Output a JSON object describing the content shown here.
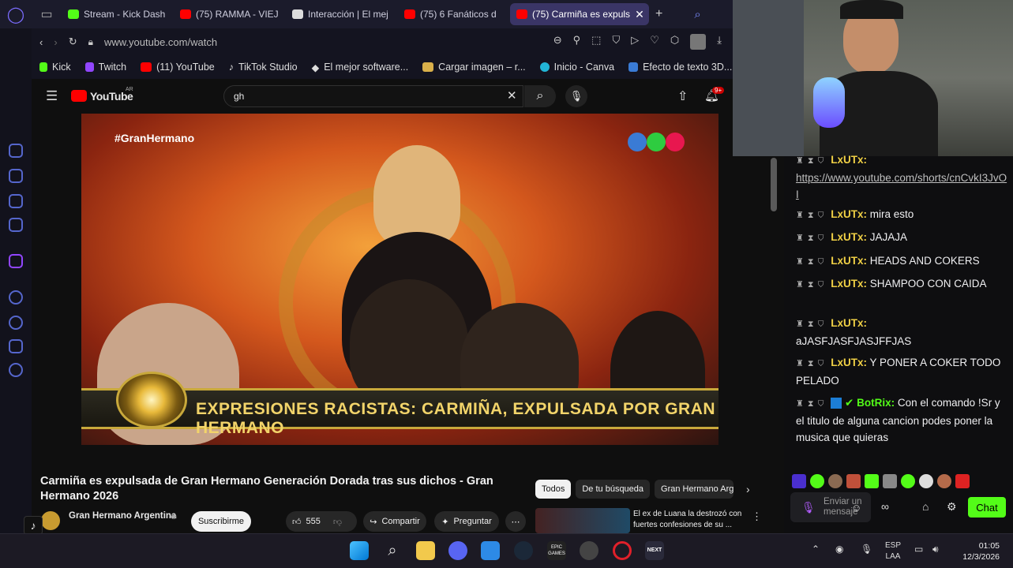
{
  "browser": {
    "tabs": [
      {
        "label": "Stream - Kick Dash",
        "color": "#53fc18"
      },
      {
        "label": "(75) RAMMA - VIEJ",
        "color": "#ff0000"
      },
      {
        "label": "Interacción | El mej",
        "color": "#dddddd"
      },
      {
        "label": "(75) 6 Fanáticos d",
        "color": "#ff0000"
      },
      {
        "label": "(75) Carmiña es expuls",
        "color": "#ff0000"
      }
    ],
    "url": "www.youtube.com/watch",
    "bookmarks": [
      "Kick",
      "Twitch",
      "(11) YouTube",
      "TikTok Studio",
      "El mejor software...",
      "Cargar imagen – r...",
      "Inicio - Canva",
      "Efecto de texto 3D..."
    ]
  },
  "youtube": {
    "logo": "YouTube",
    "region": "AR",
    "search_value": "gh",
    "notif_count": "9+",
    "video": {
      "hashtag": "#GranHermano",
      "banner": "EXPRESIONES RACISTAS: CARMIÑA, EXPULSADA POR GRAN HERMANO",
      "title": "Carmiña es expulsada de Gran Hermano Generación Dorada tras sus dichos - Gran Hermano 2026"
    },
    "channel": "Gran Hermano Argentina",
    "subscribe": "Suscribirme",
    "likes": "555",
    "share": "Compartir",
    "ask": "Preguntar",
    "chips": [
      "Todos",
      "De tu búsqueda",
      "Gran Hermano Argen"
    ],
    "next_video": "El ex de Luana la destrozó con fuertes confesiones de su ..."
  },
  "chat": {
    "messages": [
      {
        "user": "LxUTx:",
        "text": "https://www.youtube.com/shorts/cnCvkI3JvOI",
        "link": true
      },
      {
        "user": "LxUTx:",
        "text": "mira esto"
      },
      {
        "user": "LxUTx:",
        "text": "JAJAJA"
      },
      {
        "user": "LxUTx:",
        "text": "HEADS AND COKERS"
      },
      {
        "user": "LxUTx:",
        "text": "SHAMPOO CON CAIDA"
      },
      {
        "user": "LxUTx:",
        "text": "aJASFJASFJASJFFJAS"
      },
      {
        "user": "LxUTx:",
        "text": "Y PONER A COKER TODO PELADO"
      },
      {
        "user": "BotRix:",
        "text": "Con el comando !Sr y el titulo de alguna cancion podes poner la musica que quieras"
      }
    ],
    "input_placeholder": "Enviar un mensaje",
    "send_label": "Chat"
  },
  "taskbar": {
    "lang": "ESP",
    "layout": "LAA",
    "time": "01:05",
    "date": "12/3/2026",
    "epic": "EPIC GAMES",
    "next": "NEXT"
  }
}
